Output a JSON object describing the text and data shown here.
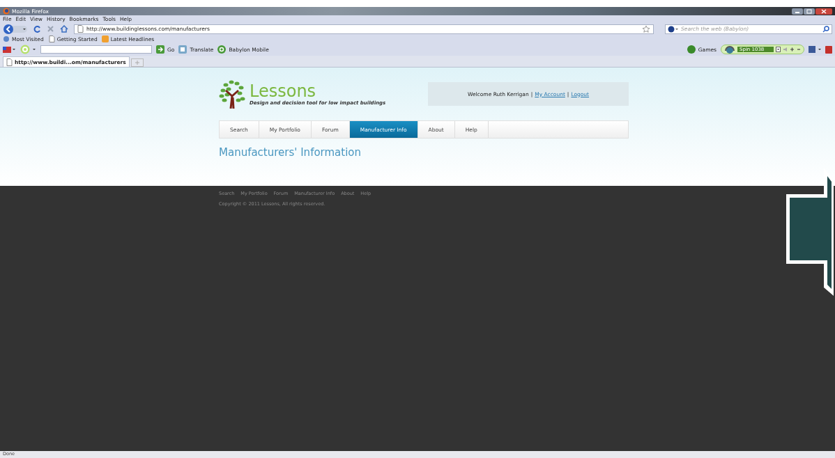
{
  "window": {
    "title": "Mozilla Firefox"
  },
  "menu": [
    "File",
    "Edit",
    "View",
    "History",
    "Bookmarks",
    "Tools",
    "Help"
  ],
  "navigation": {
    "url": "http://www.buildinglessons.com/manufacturers",
    "search_placeholder": "Search the web (Babylon)"
  },
  "bookmarks": [
    "Most Visited",
    "Getting Started",
    "Latest Headlines"
  ],
  "babylon_toolbar": {
    "go": "Go",
    "translate": "Translate",
    "mobile": "Babylon Mobile",
    "games": "Games",
    "radio": "Spin 1038"
  },
  "tabs": [
    {
      "label": "http://www.buildi...om/manufacturers",
      "selected": true
    }
  ],
  "page": {
    "logo": "Lessons",
    "tagline": "Design and decision tool for low impact buildings",
    "welcome": "Welcome Ruth Kerrigan",
    "account_links": [
      {
        "separator": "|",
        "label": "My Account"
      },
      {
        "separator": "|",
        "label": "Logout"
      }
    ],
    "nav": [
      {
        "label": "Search",
        "selected": false
      },
      {
        "label": "My Portfolio",
        "selected": false
      },
      {
        "label": "Forum",
        "selected": false
      },
      {
        "label": "Manufacturer Info",
        "selected": true
      },
      {
        "label": "About",
        "selected": false
      },
      {
        "label": "Help",
        "selected": false
      }
    ],
    "heading": "Manufacturers' Information",
    "footer_links": [
      "Search",
      "My Portfolio",
      "Forum",
      "Manufacturer Info",
      "About",
      "Help"
    ],
    "copyright": "Copyright © 2011 Lessons, All rights reserved."
  },
  "status_bar": "Done"
}
